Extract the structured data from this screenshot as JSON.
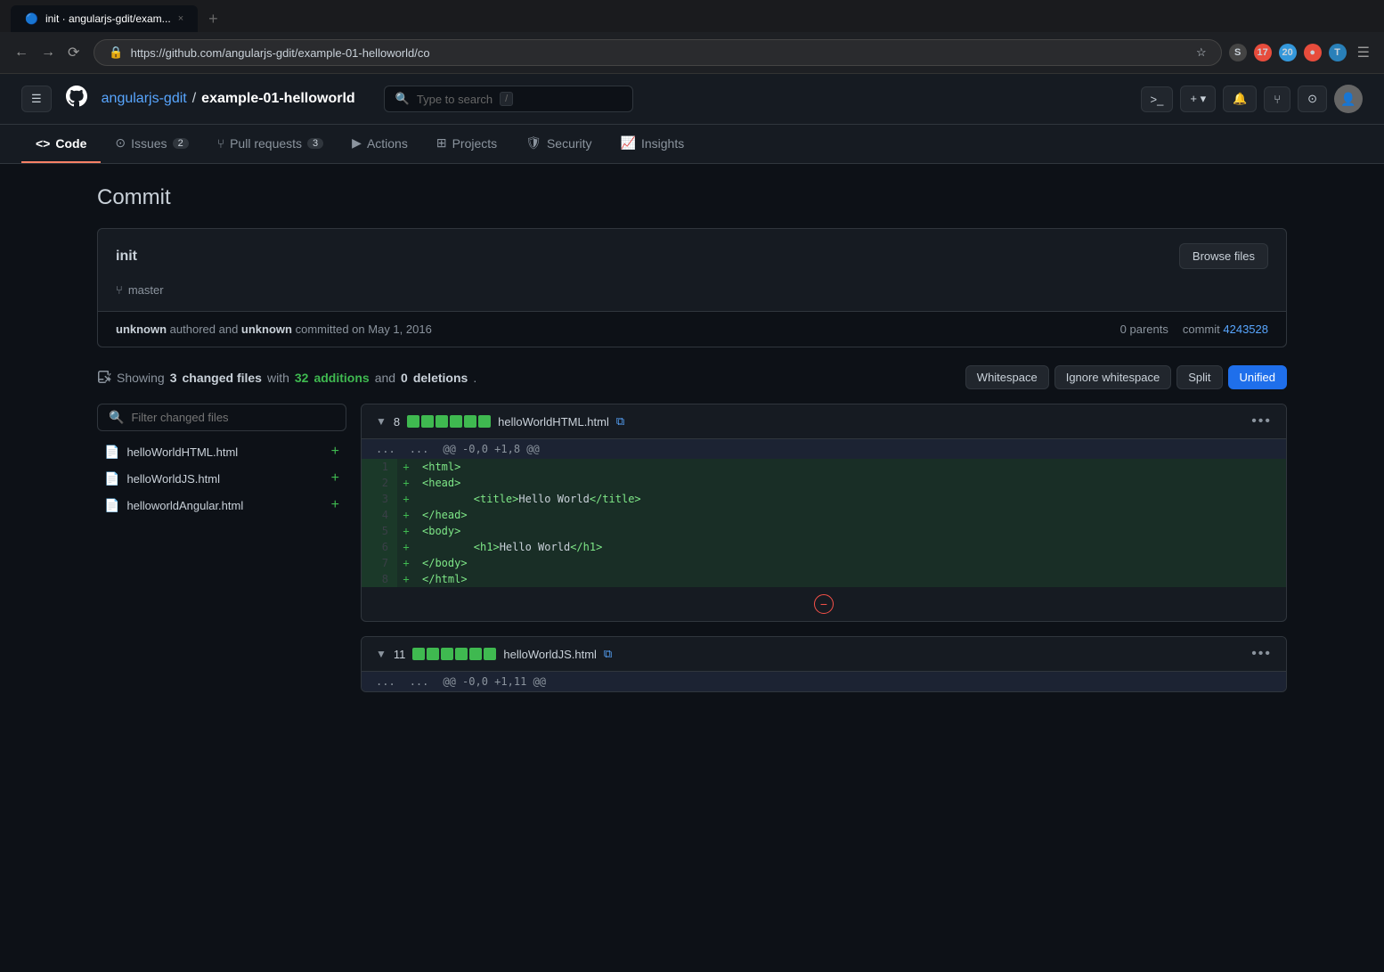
{
  "browser": {
    "tabs": [
      {
        "label": "init · angularjs-gdit/exam...",
        "active": true
      },
      {
        "label": "+",
        "new": true
      }
    ],
    "url": "https://github.com/angularjs-gdit/example-01-helloworld/co",
    "tab_close": "×"
  },
  "github": {
    "logo": "●",
    "breadcrumb": {
      "org": "angularjs-gdit",
      "sep": "/",
      "repo": "example-01-helloworld"
    },
    "search": {
      "placeholder": "Type to search",
      "kbd": "/"
    },
    "nav": [
      {
        "id": "code",
        "label": "Code",
        "icon": "<>",
        "active": true
      },
      {
        "id": "issues",
        "label": "Issues",
        "badge": "2"
      },
      {
        "id": "pull-requests",
        "label": "Pull requests",
        "badge": "3"
      },
      {
        "id": "actions",
        "label": "Actions"
      },
      {
        "id": "projects",
        "label": "Projects"
      },
      {
        "id": "security",
        "label": "Security"
      },
      {
        "id": "insights",
        "label": "Insights"
      }
    ]
  },
  "page": {
    "title": "Commit",
    "commit": {
      "message": "init",
      "branch": "master",
      "author": "unknown",
      "committer": "unknown",
      "date": "May 1, 2016",
      "parents": "0 parents",
      "parents_label": "parents",
      "commit_label": "commit",
      "hash": "4243528",
      "browse_files_label": "Browse files",
      "authored_text": "authored and",
      "committed_text": "committed on"
    },
    "diff": {
      "summary": {
        "showing": "Showing",
        "changed_count": "3",
        "changed_label": "changed files",
        "with": "with",
        "additions_count": "32",
        "additions_label": "additions",
        "and": "and",
        "deletions_count": "0",
        "deletions_label": "deletions"
      },
      "options": {
        "whitespace_label": "Whitespace",
        "ignore_label": "Ignore whitespace",
        "split_label": "Split",
        "unified_label": "Unified",
        "active": "unified"
      },
      "filter_placeholder": "Filter changed files",
      "file_tree": [
        {
          "name": "helloWorldHTML.html",
          "badge": "+"
        },
        {
          "name": "helloWorldJS.html",
          "badge": "+"
        },
        {
          "name": "helloworldAngular.html",
          "badge": "+"
        }
      ],
      "files": [
        {
          "id": "file1",
          "count": "8",
          "name": "helloWorldHTML.html",
          "hunk_header": "@@ -0,0 +1,8 @@",
          "lines": [
            {
              "num": "",
              "sign": "...",
              "code": "",
              "type": "dots"
            },
            {
              "num": "1",
              "sign": "+",
              "code": "<html>",
              "type": "added"
            },
            {
              "num": "2",
              "sign": "+",
              "code": "<head>",
              "type": "added"
            },
            {
              "num": "3",
              "sign": "+",
              "code": "        <title>Hello World</title>",
              "type": "added"
            },
            {
              "num": "4",
              "sign": "+",
              "code": "</head>",
              "type": "added"
            },
            {
              "num": "5",
              "sign": "+",
              "code": "<body>",
              "type": "added"
            },
            {
              "num": "6",
              "sign": "+",
              "code": "        <h1>Hello World</h1>",
              "type": "added"
            },
            {
              "num": "7",
              "sign": "+",
              "code": "</body>",
              "type": "added"
            },
            {
              "num": "8",
              "sign": "+",
              "code": "</html>",
              "type": "added"
            }
          ]
        },
        {
          "id": "file2",
          "count": "11",
          "name": "helloWorldJS.html",
          "hunk_header": "@@ -0,0 +1,11 @@",
          "lines": [
            {
              "num": "",
              "sign": "...",
              "code": "",
              "type": "dots"
            }
          ]
        }
      ]
    }
  }
}
